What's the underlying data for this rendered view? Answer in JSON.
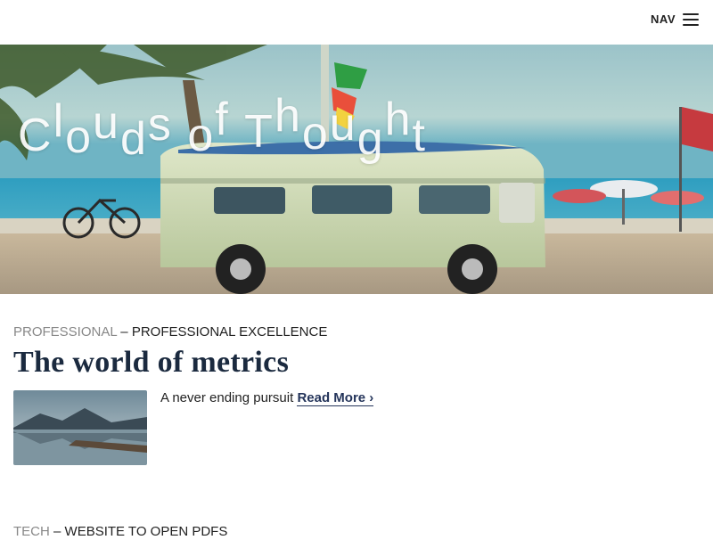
{
  "header": {
    "nav_label": "NAV"
  },
  "hero": {
    "site_title": "Clouds of Thought"
  },
  "posts": [
    {
      "category": "PROFESSIONAL",
      "separator": " – ",
      "subcategory": "PROFESSIONAL EXCELLENCE",
      "title": "The world of metrics",
      "excerpt": "A never ending pursuit ",
      "read_more": "Read More ›"
    },
    {
      "category": "TECH",
      "separator": " – ",
      "subcategory": "WEBSITE TO OPEN PDFS"
    }
  ],
  "colors": {
    "title": "#1b2a3f",
    "link": "#25355b",
    "category": "#888888"
  }
}
